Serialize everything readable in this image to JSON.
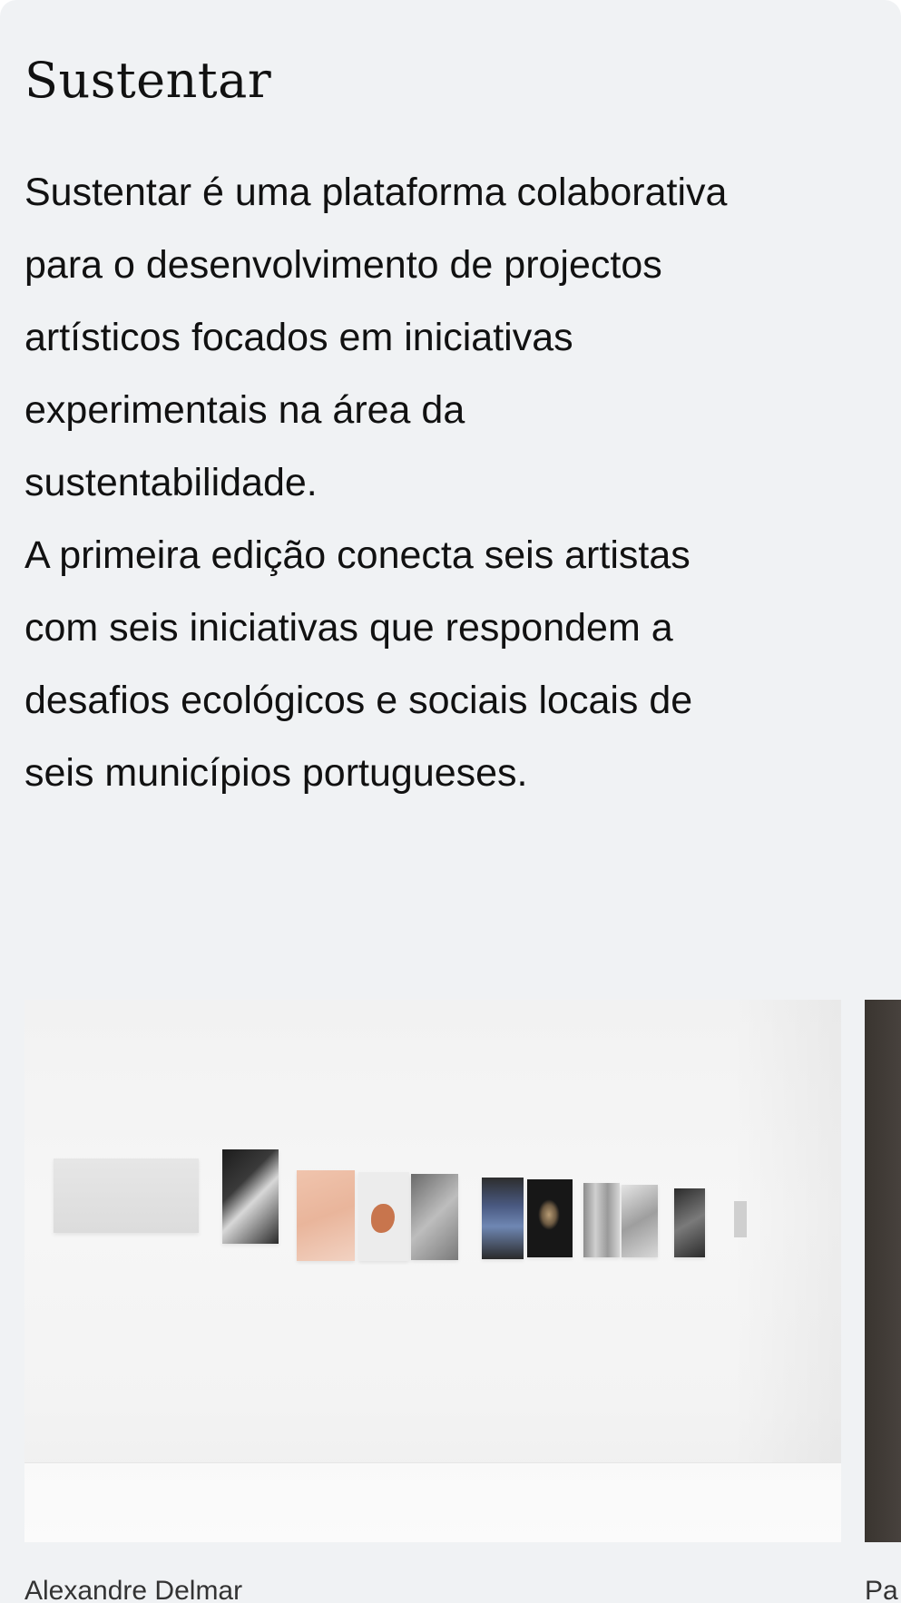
{
  "section": {
    "title": "Sustentar",
    "paragraph_1": "Sustentar é uma plataforma colaborativa\npara o desenvolvimento de projectos\nartísticos focados em iniciativas\nexperimentais na área da\nsustentabilidade.",
    "paragraph_2": "A primeira edição conecta seis artistas\ncom seis iniciativas que respondem a\ndesafios ecológicos e sociais locais de\nseis municípios portugueses."
  },
  "gallery": {
    "slides": [
      {
        "caption": "Alexandre Delmar"
      },
      {
        "caption": "Pa"
      }
    ]
  },
  "colors": {
    "card_background": "#f0f2f4",
    "text": "#111111",
    "caption_text": "#333333"
  }
}
